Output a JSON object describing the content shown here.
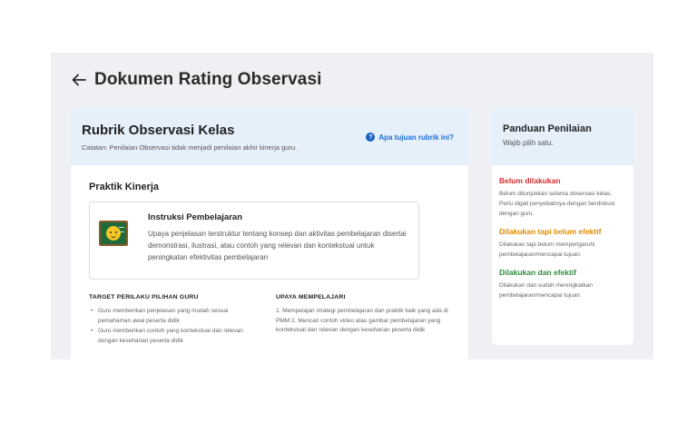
{
  "header": {
    "title": "Dokumen Rating Observasi"
  },
  "main": {
    "title": "Rubrik Observasi Kelas",
    "note": "Catatan: Penilaian Observasi tidak menjadi penilaian akhir kinerja guru.",
    "help_link": "Apa tujuan rubrik ini?",
    "section_label": "Praktik Kinerja",
    "practice": {
      "title": "Instruksi Pembelajaran",
      "description": "Upaya penjelasan terstruktur tentang konsep dan aktivitas pembelajaran disertai demonstrasi, ilustrasi, atau contoh yang relevan dan kontekstual untuk peningkatan efektivitas pembelajaran"
    },
    "target": {
      "heading": "TARGET PERILAKU PILIHAN GURU",
      "items": [
        "Guru memberikan penjelasan yang mudah sesuai pemahaman awal peserta didik",
        "Guru memberikan contoh yang kontekstual dan relevan dengan keseharian peserta didik"
      ]
    },
    "learn": {
      "heading": "UPAYA MEMPELAJARI",
      "text": "1. Mempelajari strategi pembelajaran dan praktik baik yang ada di PMM 2. Mencari contoh video atau gambar pembelajaran yang kontekstual dan relevan dengan keseharian peserta didik"
    }
  },
  "guide": {
    "title": "Panduan Penilaian",
    "subtitle": "Wajib pilih satu.",
    "levels": [
      {
        "title": "Belum dilakukan",
        "color": "#d32f2f",
        "desc": "Belum ditunjukkan selama observasi kelas. Perlu digali penyebabnya dengan berdiskusi dengan guru."
      },
      {
        "title": "Dilakukan tapi belum efektif",
        "color": "#e08a00",
        "desc": "Dilakukan tapi belum mempengaruhi pembelajaran/mencapai tujuan."
      },
      {
        "title": "Dilakukan dan efektif",
        "color": "#2e8b3e",
        "desc": "Dilakukan dan sudah meningkatkan pembelajaran/mencapai tujuan."
      }
    ]
  }
}
